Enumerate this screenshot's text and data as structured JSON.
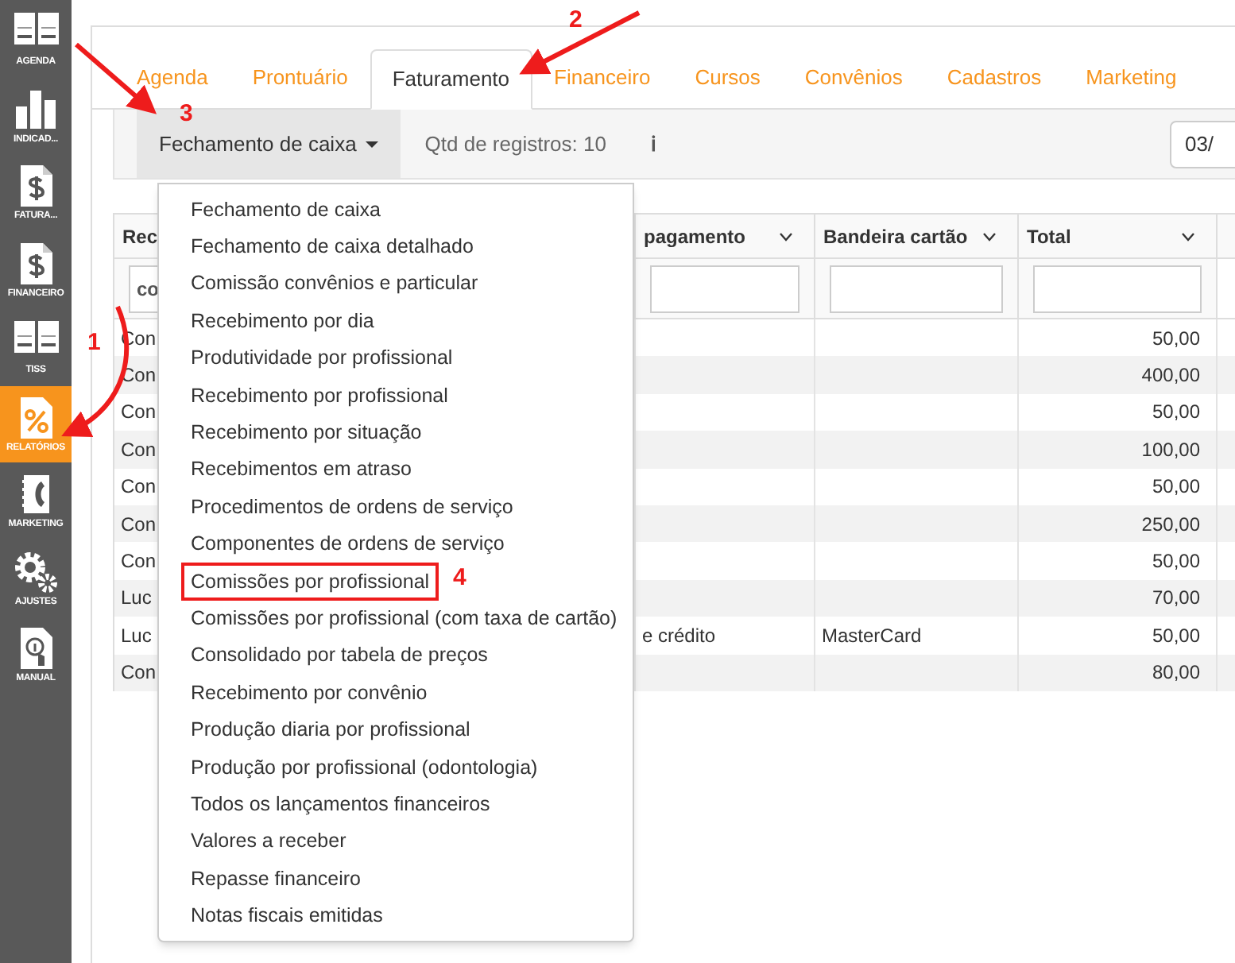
{
  "sidebar": {
    "items": [
      {
        "label": "AGENDA",
        "kind": "book",
        "selected": false
      },
      {
        "label": "INDICAD...",
        "kind": "bars",
        "selected": false
      },
      {
        "label": "FATURA...",
        "kind": "dollar",
        "selected": false
      },
      {
        "label": "FINANCEIRO",
        "kind": "dollar",
        "selected": false
      },
      {
        "label": "TISS",
        "kind": "book",
        "selected": false
      },
      {
        "label": "RELATÓRIOS",
        "kind": "percent",
        "selected": true
      },
      {
        "label": "MARKETING",
        "kind": "phone",
        "selected": false
      },
      {
        "label": "AJUSTES",
        "kind": "gears",
        "selected": false
      },
      {
        "label": "MANUAL",
        "kind": "manual",
        "selected": false
      }
    ]
  },
  "tabs": [
    {
      "label": "Agenda",
      "selected": false
    },
    {
      "label": "Prontuário",
      "selected": false
    },
    {
      "label": "Faturamento",
      "selected": true
    },
    {
      "label": "Financeiro",
      "selected": false
    },
    {
      "label": "Cursos",
      "selected": false
    },
    {
      "label": "Convênios",
      "selected": false
    },
    {
      "label": "Cadastros",
      "selected": false
    },
    {
      "label": "Marketing",
      "selected": false
    }
  ],
  "toolbar": {
    "report_dropdown": "Fechamento de caixa",
    "record_count": "Qtd de registros: 10",
    "info": "ℹ",
    "date_field": "03/"
  },
  "table": {
    "columns": [
      {
        "label": "Rec",
        "filter": "co"
      },
      {
        "label": "pagamento"
      },
      {
        "label": "Bandeira cartão"
      },
      {
        "label": "Total"
      }
    ],
    "rows": [
      [
        "Con",
        "",
        "",
        "50,00"
      ],
      [
        "Con",
        "",
        "",
        "400,00"
      ],
      [
        "Con",
        "",
        "",
        "50,00"
      ],
      [
        "Con",
        "",
        "",
        "100,00"
      ],
      [
        "Con",
        "",
        "",
        "50,00"
      ],
      [
        "Con",
        "",
        "",
        "250,00"
      ],
      [
        "Con",
        "",
        "",
        "50,00"
      ],
      [
        "Luc",
        "",
        "",
        "70,00"
      ],
      [
        "Luc",
        "e crédito",
        "MasterCard",
        "50,00"
      ],
      [
        "Con",
        "",
        "",
        "80,00"
      ]
    ]
  },
  "report_menu": {
    "items": [
      {
        "label": "Fechamento de caixa",
        "annotated": false
      },
      {
        "label": "Fechamento de caixa detalhado",
        "annotated": false
      },
      {
        "label": "Comissão convênios e particular",
        "annotated": false
      },
      {
        "label": "Recebimento por dia",
        "annotated": false
      },
      {
        "label": "Produtividade por profissional",
        "annotated": false
      },
      {
        "label": "Recebimento por profissional",
        "annotated": false
      },
      {
        "label": "Recebimento por situação",
        "annotated": false
      },
      {
        "label": "Recebimentos em atraso",
        "annotated": false
      },
      {
        "label": "Procedimentos de ordens de serviço",
        "annotated": false
      },
      {
        "label": "Componentes de ordens de serviço",
        "annotated": false
      },
      {
        "label": "Comissões por profissional",
        "annotated": true
      },
      {
        "label": "Comissões por profissional (com taxa de cartão)",
        "annotated": false
      },
      {
        "label": "Consolidado por tabela de preços",
        "annotated": false
      },
      {
        "label": "Recebimento por convênio",
        "annotated": false
      },
      {
        "label": "Produção diaria por profissional",
        "annotated": false
      },
      {
        "label": "Produção por profissional (odontologia)",
        "annotated": false
      },
      {
        "label": "Todos os lançamentos financeiros",
        "annotated": false
      },
      {
        "label": "Valores a receber",
        "annotated": false
      },
      {
        "label": "Repasse financeiro",
        "annotated": false
      },
      {
        "label": "Notas fiscais emitidas",
        "annotated": false
      }
    ]
  },
  "annotations": [
    {
      "number": "1"
    },
    {
      "number": "2"
    },
    {
      "number": "3"
    },
    {
      "number": "4"
    }
  ]
}
